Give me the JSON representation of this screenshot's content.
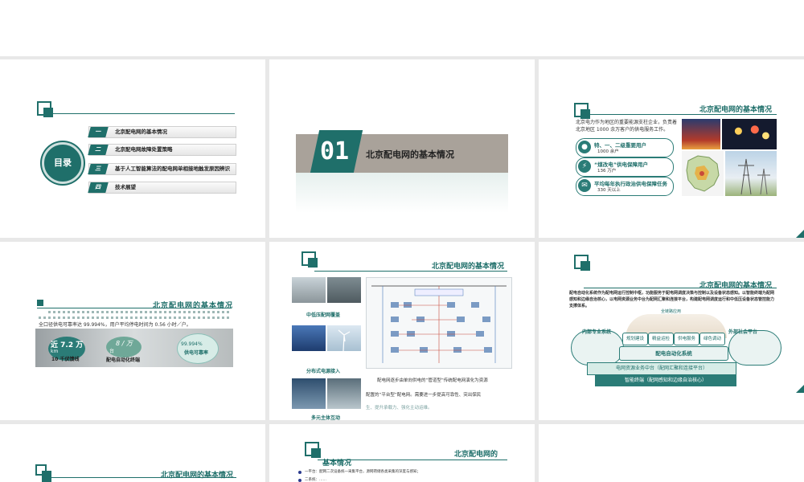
{
  "slide1": {
    "toc_title": "目录",
    "items": [
      {
        "num": "一",
        "label": "北京配电网的基本情况"
      },
      {
        "num": "二",
        "label": "北京配电网故障处置策略"
      },
      {
        "num": "三",
        "label": "基于人工智能算法的配电网单相接地触发原因辨识"
      },
      {
        "num": "四",
        "label": "技术展望"
      }
    ]
  },
  "slide2": {
    "number": "01",
    "title": "北京配电网的基本情况"
  },
  "slide3": {
    "title": "北京配电网的基本情况",
    "intro": "北京电力作为地区的重要能源支柱企业，负责着北京地区 1000 余万客户的供电服务工作。",
    "stats": [
      {
        "label": "特、一、二级重要用户",
        "value": "1000 余户"
      },
      {
        "label": "“煤改电”供电保障用户",
        "value": "136 万户"
      },
      {
        "label": "平均每年执行政治供电保障任务",
        "value": "330 天以上"
      }
    ]
  },
  "slide4": {
    "title": "北京配电网的基本情况",
    "text": "全口径供电可靠率达 99.994%，用户平均停电时间为 0.56 小时／户。",
    "badge1_value": "近 7.2 万",
    "badge1_unit": "km",
    "badge1_label": "10 千伏馈线",
    "badge2_value": "8 / 万",
    "badge2_unit": "台",
    "badge2_label": "配电自动化终端",
    "badge3_value": "99.994%",
    "badge3_label": "供电可靠率"
  },
  "slide5": {
    "title": "北京配电网的基本情况",
    "label1": "中低压配网覆盖",
    "label2": "分布式电源接入",
    "label3": "多元主体互动",
    "text1": "配电网逐步由单向供电的“管道型”传统配电网演化为资源",
    "text2": "配置的“平台型”配电网。需要进一步提高可靠性、突出保民",
    "text3": "生、提升承载力、强化主动运维。"
  },
  "slide6": {
    "title": "北京配电网的基本情况",
    "intro": "配电自动化系统作为配电网运行控制中枢，功能服务于配电网调度决策与控制以及设备状态感知。以智能终端为配网感知和边缘自治核心，以电网资源业务中台为配网汇聚和连接平台，构建配电网调度运行和中低压设备状态管控能力支撑体系。",
    "left_label": "内部专业系统",
    "right_label": "外部社会平台",
    "top_label": "全链路应用",
    "modules": [
      "规划建设",
      "精益运检",
      "供电服务",
      "绿色调动"
    ],
    "core": "配电自动化系统",
    "mid": "电网资源业务中台（配网汇聚和连接平台）",
    "bottom": "智能终端（配网感知和边缘自治核心）"
  },
  "slide7": {
    "title": "北京配电网的基本情况"
  },
  "slide8": {
    "title": "北京配电网的",
    "title2": "基本情况",
    "bullet1": "一平台：配网二次设备统一采集平台，源网荷储各类采集的深度与感知；",
    "bullet2": "二系统：……"
  }
}
